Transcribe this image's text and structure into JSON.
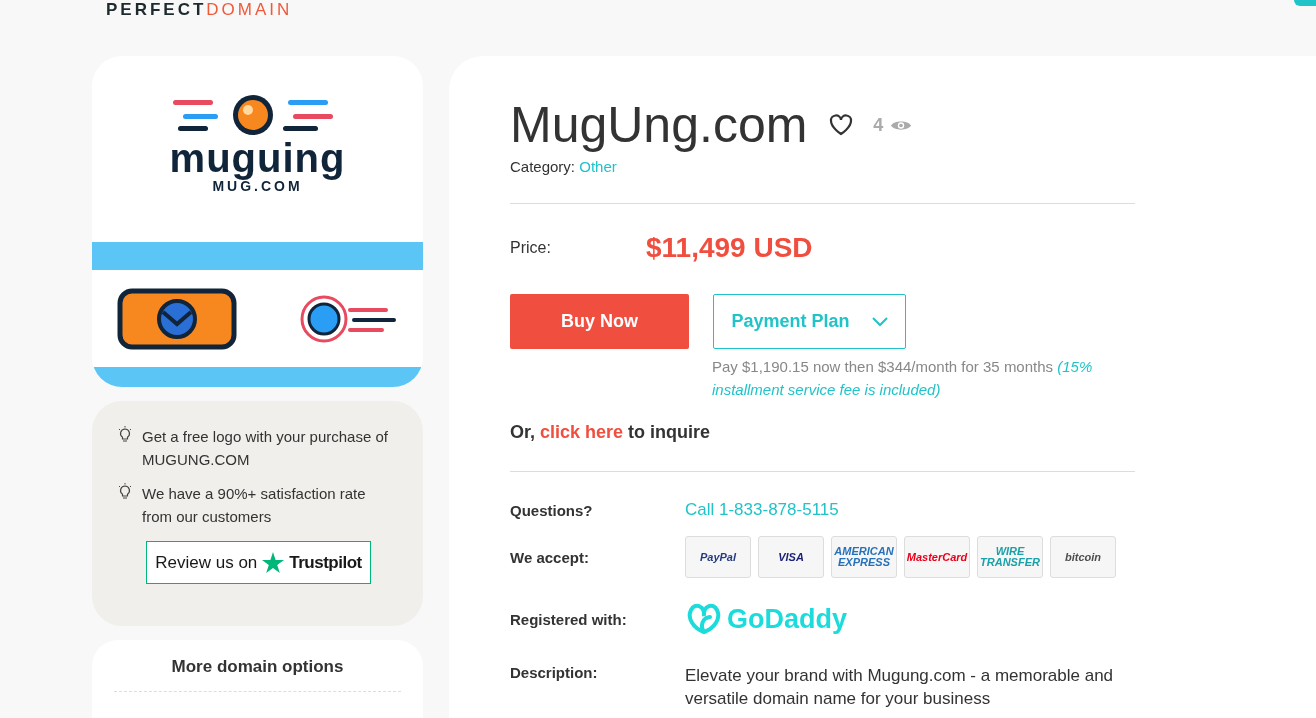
{
  "brand": {
    "part_1": "PERFECT",
    "part_2": "DOMAIN"
  },
  "domain_logo": {
    "name": "muguing",
    "tagline": "MUG.COM"
  },
  "perks": [
    "Get a free logo with your purchase of MUGUNG.COM",
    "We have a 90%+ satisfaction rate from our customers"
  ],
  "review": {
    "label": "Review us on",
    "brand": "Trustpilot"
  },
  "more_options": {
    "title": "More domain options"
  },
  "domain": {
    "name": "MugUng.com",
    "favorited": false,
    "views": "4"
  },
  "category": {
    "label": "Category:",
    "value": "Other"
  },
  "price": {
    "label": "Price:",
    "value": "$11,499 USD"
  },
  "buy_button": "Buy Now",
  "payment_plan": {
    "label": "Payment Plan",
    "expanded": false,
    "note": "Pay $1,190.15 now then $344/month for 35 months ",
    "fee": "(15% installment service fee is included)"
  },
  "inquire": {
    "before": "Or, ",
    "link": "click here",
    "after": " to inquire"
  },
  "details": [
    {
      "kind": "link",
      "label": "Questions?",
      "value": "Call 1-833-878-5115"
    },
    {
      "kind": "payments",
      "label": "We accept:",
      "cards": [
        {
          "text": "PayPal",
          "color": "#253b80"
        },
        {
          "text": "VISA",
          "color": "#1a1f71"
        },
        {
          "text": "AMERICAN EXPRESS",
          "color": "#2671b9"
        },
        {
          "text": "MasterCard",
          "color": "#eb001b"
        },
        {
          "text": "WIRE TRANSFER",
          "color": "#1aa0a8"
        },
        {
          "text": "bitcoin",
          "color": "#4d4d4d"
        }
      ]
    },
    {
      "kind": "registrar",
      "label": "Registered with:",
      "value": "GoDaddy"
    },
    {
      "kind": "text",
      "label": "Description:",
      "value": "Elevate your brand with Mugung.com - a memorable and versatile domain name for your business"
    }
  ]
}
